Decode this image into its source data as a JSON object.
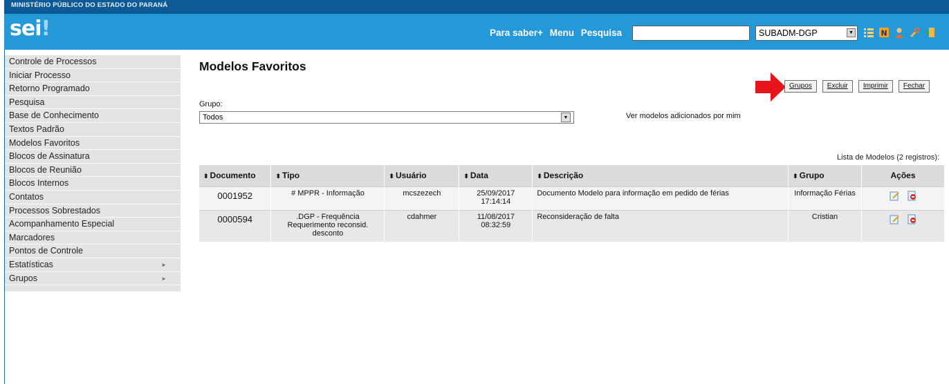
{
  "header": {
    "org": "MINISTÉRIO PÚBLICO DO ESTADO DO PARANÁ",
    "logo": "sei",
    "logo_mark": "!",
    "nav": [
      "Para saber+",
      "Menu",
      "Pesquisa"
    ],
    "search_value": "",
    "unit": "SUBADM-DGP",
    "icons": [
      "list-icon",
      "n-badge-icon",
      "user-icon",
      "wrench-icon",
      "exit-icon"
    ]
  },
  "sidebar": {
    "items": [
      {
        "label": "Controle de Processos"
      },
      {
        "label": "Iniciar Processo"
      },
      {
        "label": "Retorno Programado"
      },
      {
        "label": "Pesquisa"
      },
      {
        "label": "Base de Conhecimento"
      },
      {
        "label": "Textos Padrão"
      },
      {
        "label": "Modelos Favoritos"
      },
      {
        "label": "Blocos de Assinatura"
      },
      {
        "label": "Blocos de Reunião"
      },
      {
        "label": "Blocos Internos"
      },
      {
        "label": "Contatos"
      },
      {
        "label": "Processos Sobrestados"
      },
      {
        "label": "Acompanhamento Especial"
      },
      {
        "label": "Marcadores"
      },
      {
        "label": "Pontos de Controle"
      },
      {
        "label": "Estatísticas",
        "submenu": true
      },
      {
        "label": "Grupos",
        "submenu": true
      }
    ]
  },
  "main": {
    "title": "Modelos Favoritos",
    "buttons": {
      "grupos": "Grupos",
      "excluir": "Excluir",
      "imprimir": "Imprimir",
      "fechar": "Fechar"
    },
    "grupo_label": "Grupo:",
    "grupo_value": "Todos",
    "ver_link": "Ver modelos adicionados por mim",
    "caption": "Lista de Modelos (2 registros):",
    "columns": {
      "documento": "Documento",
      "tipo": "Tipo",
      "usuario": "Usuário",
      "data": "Data",
      "descricao": "Descrição",
      "grupo": "Grupo",
      "acoes": "Ações"
    },
    "rows": [
      {
        "documento": "0001952",
        "tipo_l1": "# MPPR - Informação",
        "tipo_l2": "",
        "tipo_l3": "",
        "usuario": "mcszezech",
        "data_l1": "25/09/2017",
        "data_l2": "17:14:14",
        "descricao": "Documento Modelo para informação em pedido de férias",
        "grupo": "Informação Férias"
      },
      {
        "documento": "0000594",
        "tipo_l1": ".DGP - Frequência",
        "tipo_l2": "Requerimento reconsid.",
        "tipo_l3": "desconto",
        "usuario": "cdahmer",
        "data_l1": "11/08/2017",
        "data_l2": "08:32:59",
        "descricao": "Reconsideração de falta",
        "grupo": "Cristian"
      }
    ]
  },
  "colors": {
    "header": "#2599d8",
    "topbar": "#0d5a96",
    "sidebar": "#e4e4e4",
    "annotation_arrow": "#e8141c"
  }
}
